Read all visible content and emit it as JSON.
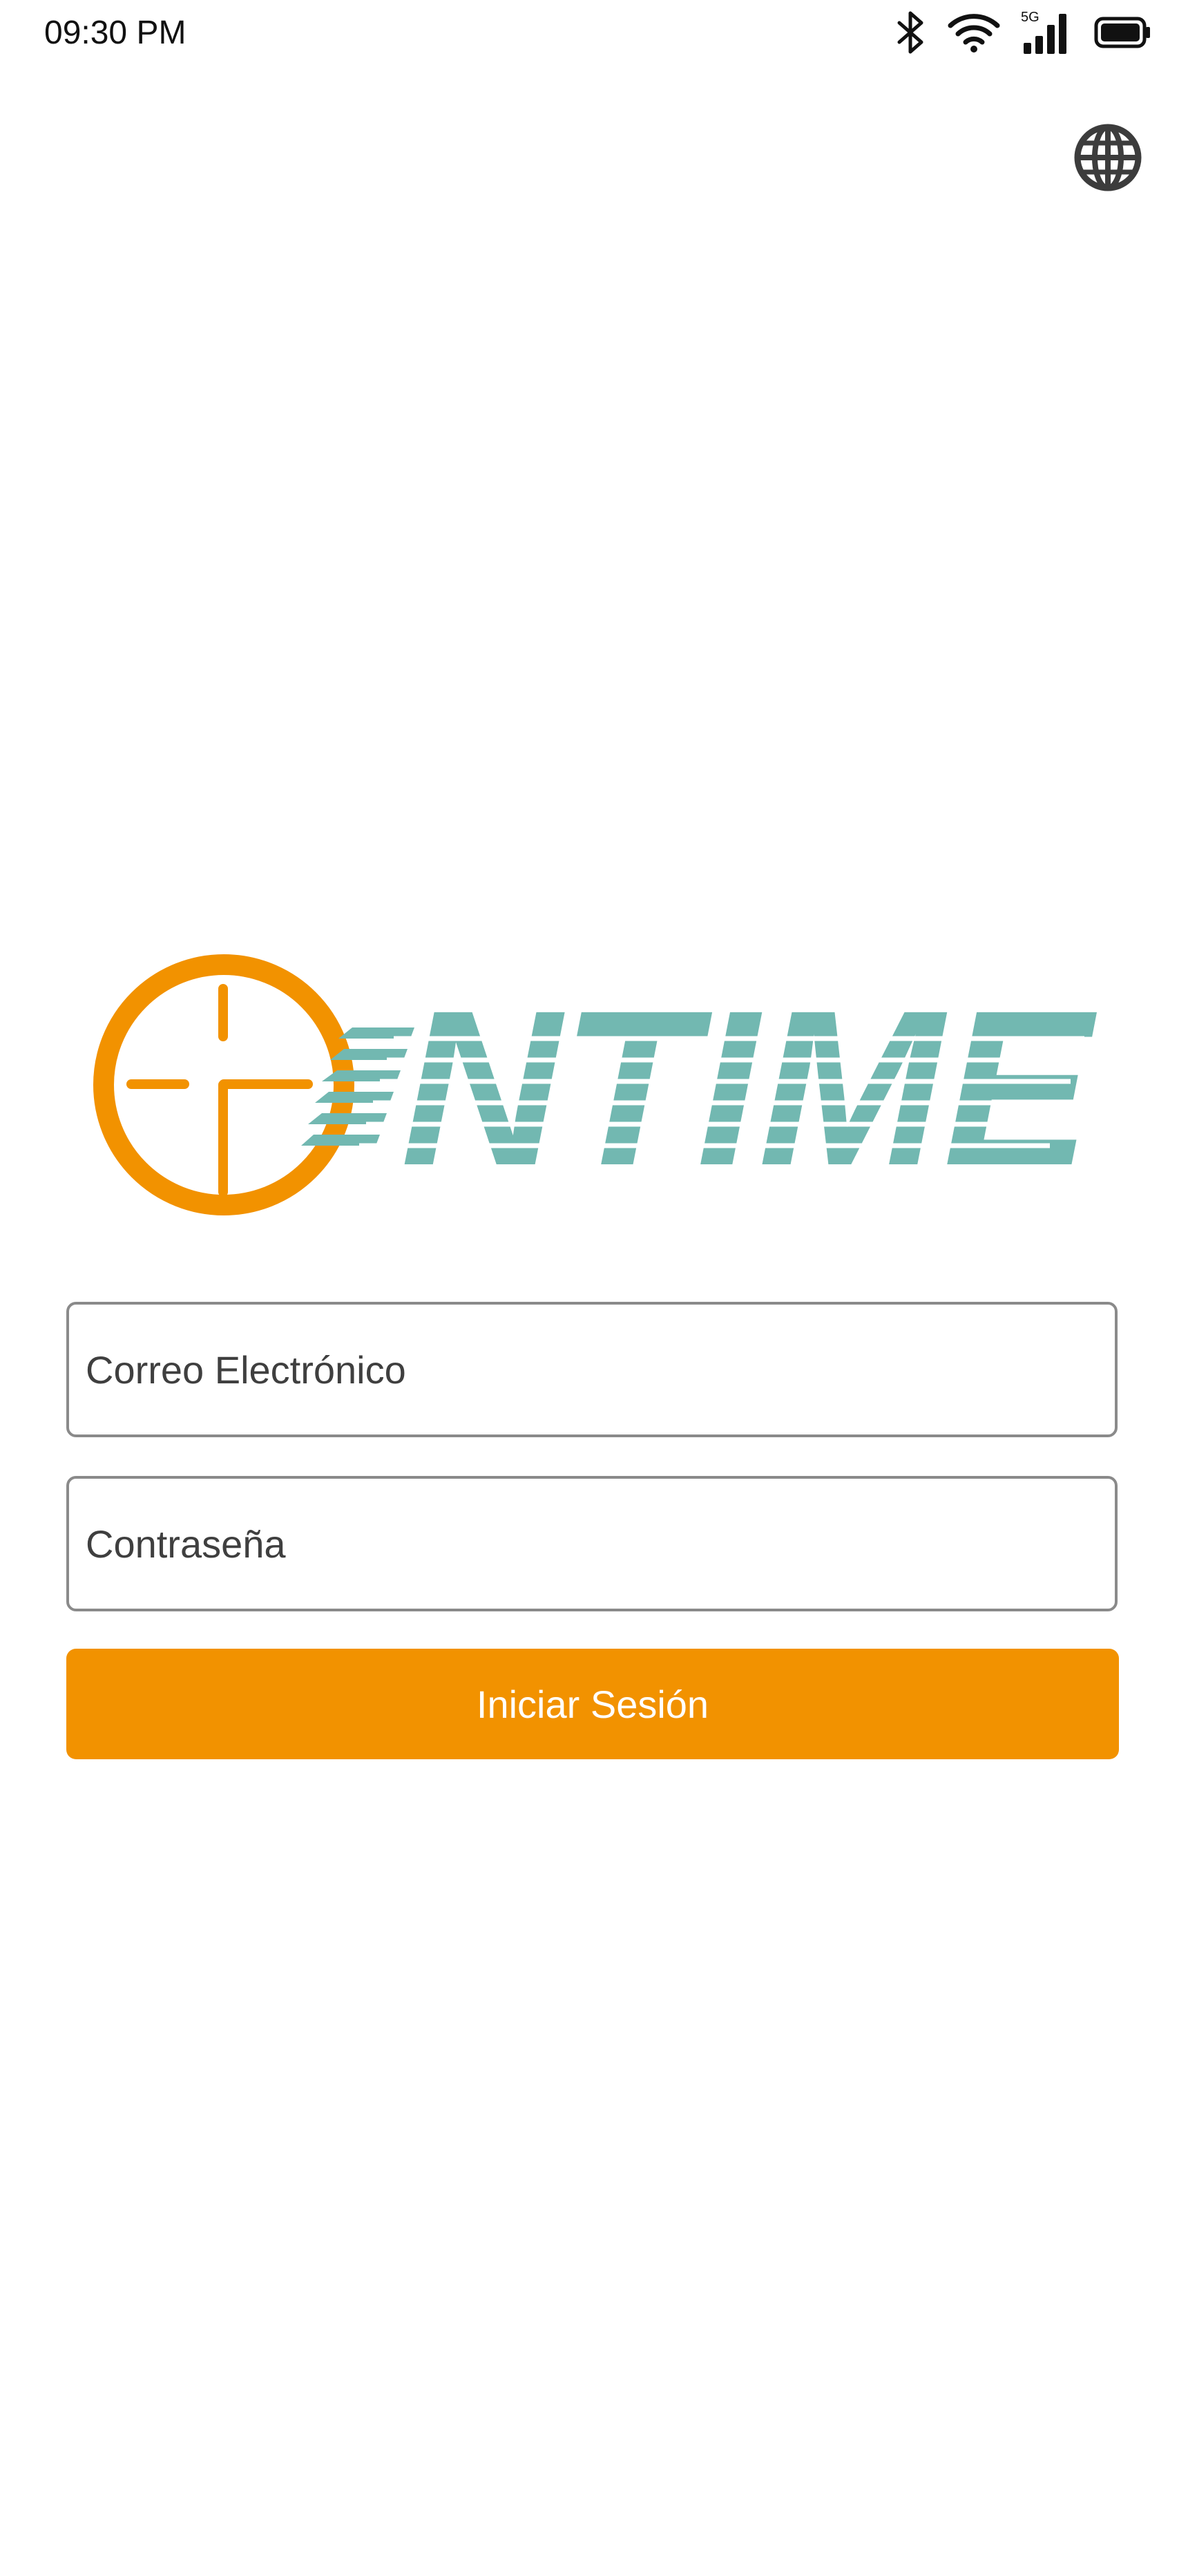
{
  "status_bar": {
    "time": "09:30 PM",
    "network_label": "5G",
    "icons": [
      "bluetooth-icon",
      "wifi-icon",
      "cellular-signal-icon",
      "battery-icon"
    ]
  },
  "header": {
    "language_icon": "globe-icon"
  },
  "logo": {
    "text": "ONTIME",
    "colors": {
      "clock": "#f29200",
      "wordmark": "#72b8b1"
    }
  },
  "login_form": {
    "email_placeholder": "Correo Electrónico",
    "email_value": "",
    "password_placeholder": "Contraseña",
    "password_value": "",
    "submit_label": "Iniciar Sesión"
  },
  "colors": {
    "accent": "#f29200",
    "field_border": "#8a8a8a",
    "background": "#ffffff"
  }
}
